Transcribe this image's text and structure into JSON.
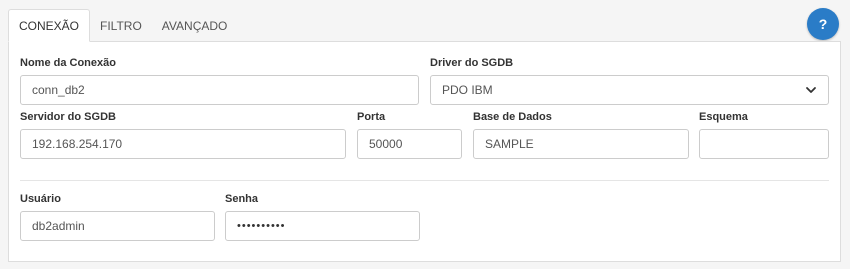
{
  "tabs": [
    {
      "label": "CONEXÃO",
      "active": true
    },
    {
      "label": "FILTRO",
      "active": false
    },
    {
      "label": "AVANÇADO",
      "active": false
    }
  ],
  "help_button": {
    "label": "?",
    "color": "#2a7cc7"
  },
  "form": {
    "connection_name": {
      "label": "Nome da Conexão",
      "value": "conn_db2"
    },
    "driver": {
      "label": "Driver do SGDB",
      "value": "PDO IBM"
    },
    "server": {
      "label": "Servidor do SGDB",
      "value": "192.168.254.170"
    },
    "port": {
      "label": "Porta",
      "value": "50000"
    },
    "database": {
      "label": "Base de Dados",
      "value": "SAMPLE"
    },
    "schema": {
      "label": "Esquema",
      "value": ""
    },
    "user": {
      "label": "Usuário",
      "value": "db2admin"
    },
    "password": {
      "label": "Senha",
      "value": "••••••••••"
    }
  }
}
